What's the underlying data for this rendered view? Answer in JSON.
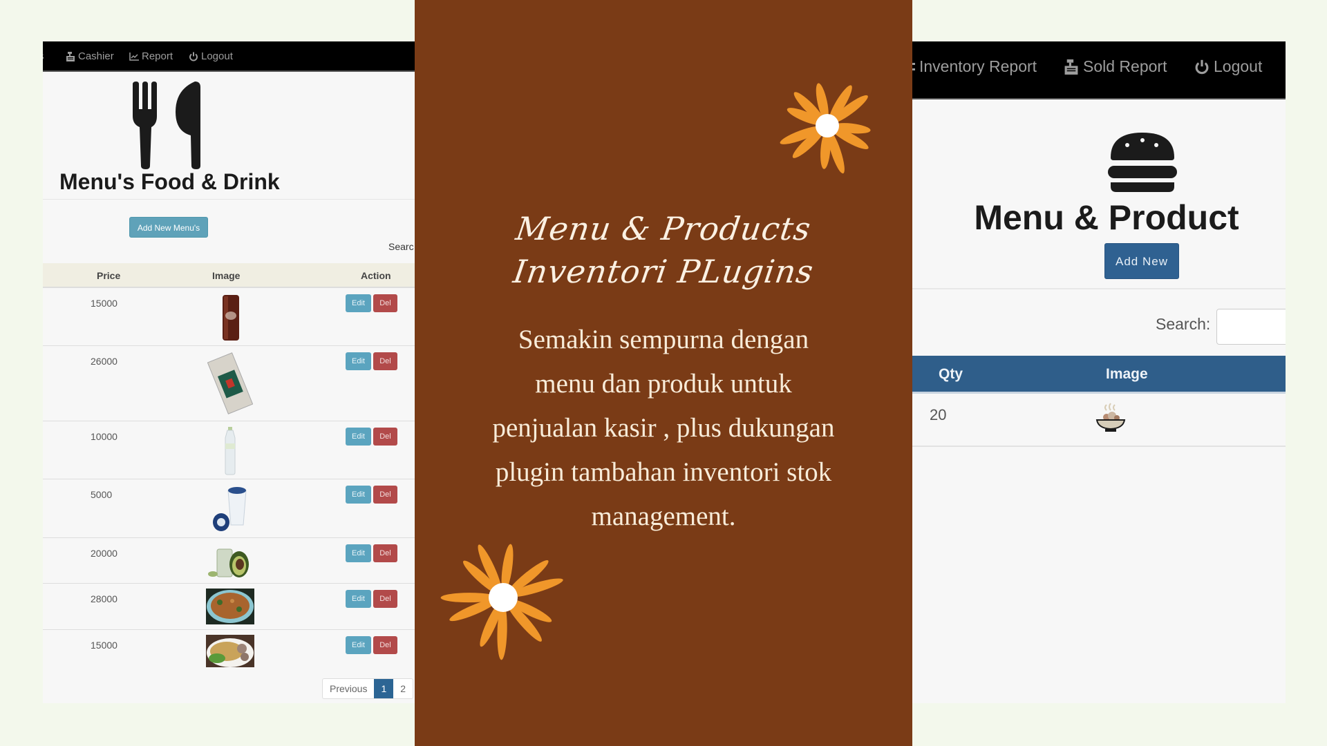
{
  "left_app": {
    "nav": [
      {
        "icon": "cash-register-icon",
        "label": "Cashier"
      },
      {
        "icon": "line-chart-icon",
        "label": "Report"
      },
      {
        "icon": "power-icon",
        "label": "Logout"
      }
    ],
    "nav_cut_fragment": "s",
    "title": "Menu's Food & Drink",
    "header_icon": "utensils-icon",
    "add_button": "Add New Menu's",
    "search_label": "Searc",
    "columns": [
      "Price",
      "Image",
      "Action"
    ],
    "rows": [
      {
        "price": "15000",
        "image": "soda-can"
      },
      {
        "price": "26000",
        "image": "cigarette-pack"
      },
      {
        "price": "10000",
        "image": "water-bottle"
      },
      {
        "price": "5000",
        "image": "water-cup"
      },
      {
        "price": "20000",
        "image": "avocado-juice"
      },
      {
        "price": "28000",
        "image": "fried-noodles"
      },
      {
        "price": "15000",
        "image": "meatball-noodles"
      }
    ],
    "edit_label": "Edit",
    "del_label": "Del",
    "pagination": {
      "previous": "Previous",
      "pages": [
        "1",
        "2"
      ],
      "current": "1"
    }
  },
  "promo": {
    "title_line1": "Menu & Products",
    "title_line2": "Inventori PLugins",
    "body_lines": [
      "Semakin sempurna dengan",
      "menu dan produk untuk",
      "penjualan kasir , plus dukungan",
      "plugin tambahan inventori stok",
      "management."
    ],
    "colors": {
      "background": "#7a3b16",
      "flower": "#f0972a",
      "flower_center": "#ffffff"
    }
  },
  "right_app": {
    "nav": [
      {
        "icon": "inventory-icon",
        "label": "Inventory Report"
      },
      {
        "icon": "cash-register-icon",
        "label": "Sold Report"
      },
      {
        "icon": "power-icon",
        "label": "Logout"
      }
    ],
    "header_icon": "hamburger-icon",
    "title": "Menu & Product",
    "add_button": "Add New",
    "search_label": "Search:",
    "search_value": "",
    "columns": [
      "Qty",
      "Image"
    ],
    "rows": [
      {
        "qty": "20",
        "image": "food-bowl"
      }
    ]
  }
}
